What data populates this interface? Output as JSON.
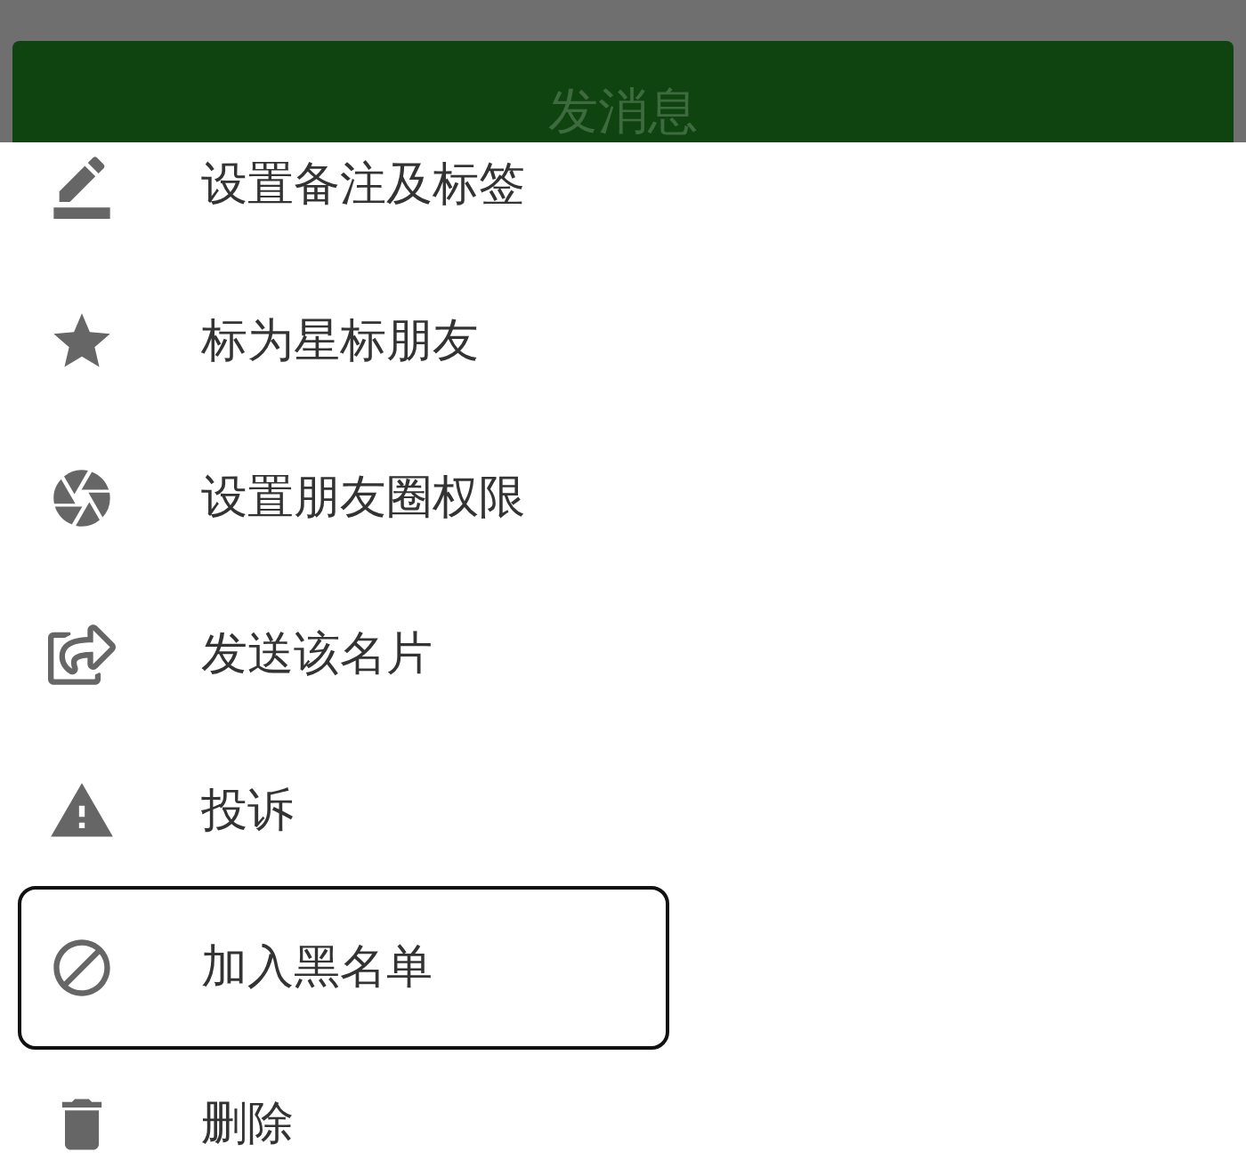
{
  "background_button": {
    "label": "发消息"
  },
  "menu": [
    {
      "label": "设置备注及标签",
      "highlighted": false
    },
    {
      "label": "标为星标朋友",
      "highlighted": false
    },
    {
      "label": "设置朋友圈权限",
      "highlighted": false
    },
    {
      "label": "发送该名片",
      "highlighted": false
    },
    {
      "label": "投诉",
      "highlighted": false
    },
    {
      "label": "加入黑名单",
      "highlighted": true
    },
    {
      "label": "删除",
      "highlighted": false
    }
  ]
}
